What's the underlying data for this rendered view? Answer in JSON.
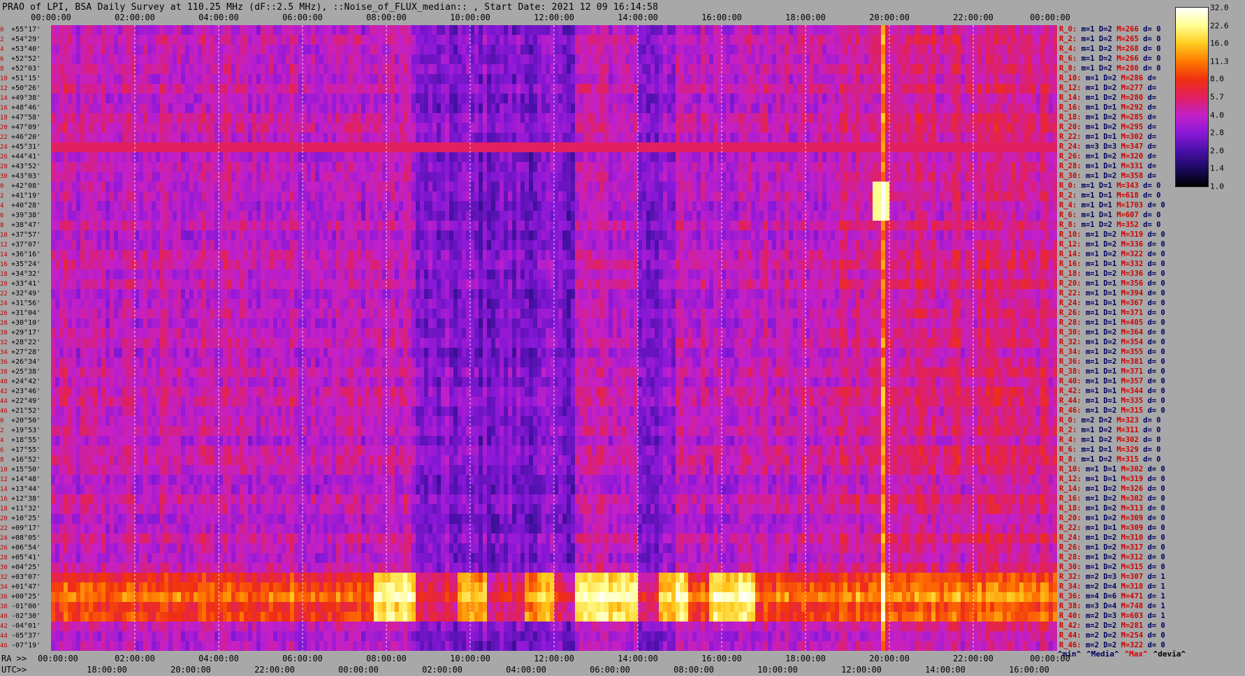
{
  "title": "PRAO of LPI, BSA Daily Survey at 110.25 MHz (dF::2.5 MHz), ::Noise_of_FLUX_median:: , Start Date: 2021 12 09 16:14:58",
  "chart_data": {
    "type": "heatmap",
    "title": "PRAO of LPI, BSA Daily Survey at 110.25 MHz (dF::2.5 MHz), ::Noise_of_FLUX_median:: , Start Date: 2021 12 09 16:14:58",
    "x_top_ticks": [
      "00:00:00",
      "02:00:00",
      "04:00:00",
      "06:00:00",
      "08:00:00",
      "10:00:00",
      "12:00:00",
      "14:00:00",
      "16:00:00",
      "18:00:00",
      "20:00:00",
      "22:00:00",
      "00:00:00"
    ],
    "x_ra_prefix": "RA >>",
    "x_ra_ticks": [
      "00:00:00",
      "02:00:00",
      "04:00:00",
      "06:00:00",
      "08:00:00",
      "10:00:00",
      "12:00:00",
      "14:00:00",
      "16:00:00",
      "18:00:00",
      "20:00:00",
      "22:00:00",
      "00:00:00"
    ],
    "x_utc_prefix": "UTC>>",
    "x_utc_ticks": [
      "18:00:00",
      "20:00:00",
      "22:00:00",
      "00:00:00",
      "02:00:00",
      "04:00:00",
      "06:00:00",
      "08:00:00",
      "10:00:00",
      "12:00:00",
      "14:00:00",
      "16:00:00"
    ],
    "declinations": [
      "+55°17'",
      "+54°29'",
      "+53°40'",
      "+52°52'",
      "+52°03'",
      "+51°15'",
      "+50°26'",
      "+49°38'",
      "+48°46'",
      "+47°58'",
      "+47°09'",
      "+46°20'",
      "+45°31'",
      "+44°41'",
      "+43°52'",
      "+43°03'",
      "+42°08'",
      "+41°19'",
      "+40°28'",
      "+39°38'",
      "+38°47'",
      "+37°57'",
      "+37°07'",
      "+36°16'",
      "+35°24'",
      "+34°32'",
      "+33°41'",
      "+32°49'",
      "+31°56'",
      "+31°04'",
      "+30°10'",
      "+29°17'",
      "+28°22'",
      "+27°28'",
      "+26°34'",
      "+25°38'",
      "+24°42'",
      "+23°46'",
      "+22°49'",
      "+21°52'",
      "+20°50'",
      "+19°53'",
      "+18°55'",
      "+17°55'",
      "+16°52'",
      "+15°50'",
      "+14°48'",
      "+13°44'",
      "+12°38'",
      "+11°32'",
      "+10°25'",
      "+09°17'",
      "+08°05'",
      "+06°54'",
      "+05°41'",
      "+04°25'",
      "+03°07'",
      "+01°47'",
      "+00°25'",
      "-01°00'",
      "-02°30'",
      "-04°01'",
      "-05°37'",
      "-07°19'"
    ],
    "beam_index": [
      "0",
      "2",
      "4",
      "6",
      "8",
      "10",
      "12",
      "14",
      "16",
      "18",
      "20",
      "22",
      "24",
      "26",
      "28",
      "30",
      "0",
      "2",
      "4",
      "6",
      "8",
      "10",
      "12",
      "14",
      "16",
      "18",
      "20",
      "22",
      "24",
      "26",
      "28",
      "30",
      "32",
      "34",
      "36",
      "38",
      "40",
      "42",
      "44",
      "46",
      "0",
      "2",
      "4",
      "6",
      "8",
      "10",
      "12",
      "14",
      "16",
      "18",
      "20",
      "22",
      "24",
      "26",
      "28",
      "30",
      "32",
      "34",
      "36",
      "38",
      "40",
      "42",
      "44",
      "46"
    ],
    "colorbar": {
      "scale": "log",
      "min": 1.0,
      "max": 32.0,
      "ticks": [
        "32.0",
        "22.6",
        "16.0",
        "11.3",
        "8.0",
        "5.7",
        "4.0",
        "2.8",
        "2.0",
        "1.4",
        "1.0"
      ],
      "colors": [
        "#000000",
        "#1a0a60",
        "#4a10a8",
        "#8a18d8",
        "#c420c8",
        "#e02060",
        "#f03010",
        "#ff7a00",
        "#ffcc20",
        "#ffff90",
        "#ffffff"
      ]
    },
    "stats_rows": [
      {
        "r": "R_0:",
        "m": "m=1",
        "d": "D=2",
        "mx": "M=266",
        "dv": "d= 0"
      },
      {
        "r": "R_2:",
        "m": "m=1",
        "d": "D=2",
        "mx": "M=265",
        "dv": "d= 0"
      },
      {
        "r": "R_4:",
        "m": "m=1",
        "d": "D=2",
        "mx": "M=268",
        "dv": "d= 0"
      },
      {
        "r": "R_6:",
        "m": "m=1",
        "d": "D=2",
        "mx": "M=266",
        "dv": "d= 0"
      },
      {
        "r": "R_8:",
        "m": "m=1",
        "d": "D=2",
        "mx": "M=280",
        "dv": "d= 0"
      },
      {
        "r": "R_10:",
        "m": "m=1",
        "d": "D=2",
        "mx": "M=286",
        "dv": "d="
      },
      {
        "r": "R_12:",
        "m": "m=1",
        "d": "D=2",
        "mx": "M=277",
        "dv": "d="
      },
      {
        "r": "R_14:",
        "m": "m=1",
        "d": "D=2",
        "mx": "M=280",
        "dv": "d="
      },
      {
        "r": "R_16:",
        "m": "m=1",
        "d": "D=1",
        "mx": "M=292",
        "dv": "d="
      },
      {
        "r": "R_18:",
        "m": "m=1",
        "d": "D=2",
        "mx": "M=285",
        "dv": "d="
      },
      {
        "r": "R_20:",
        "m": "m=1",
        "d": "D=2",
        "mx": "M=295",
        "dv": "d="
      },
      {
        "r": "R_22:",
        "m": "m=1",
        "d": "D=1",
        "mx": "M=302",
        "dv": "d="
      },
      {
        "r": "R_24:",
        "m": "m=3",
        "d": "D=3",
        "mx": "M=347",
        "dv": "d="
      },
      {
        "r": "R_26:",
        "m": "m=1",
        "d": "D=2",
        "mx": "M=320",
        "dv": "d="
      },
      {
        "r": "R_28:",
        "m": "m=1",
        "d": "D=1",
        "mx": "M=331",
        "dv": "d="
      },
      {
        "r": "R_30:",
        "m": "m=1",
        "d": "D=2",
        "mx": "M=358",
        "dv": "d="
      },
      {
        "r": "R_0:",
        "m": "m=1",
        "d": "D=1",
        "mx": "M=343",
        "dv": "d= 0"
      },
      {
        "r": "R_2:",
        "m": "m=1",
        "d": "D=1",
        "mx": "M=618",
        "dv": "d= 0"
      },
      {
        "r": "R_4:",
        "m": "m=1",
        "d": "D=1",
        "mx": "M=1703",
        "dv": "d= 0"
      },
      {
        "r": "R_6:",
        "m": "m=1",
        "d": "D=1",
        "mx": "M=607",
        "dv": "d= 0"
      },
      {
        "r": "R_8:",
        "m": "m=1",
        "d": "D=2",
        "mx": "M=352",
        "dv": "d= 0"
      },
      {
        "r": "R_10:",
        "m": "m=1",
        "d": "D=2",
        "mx": "M=319",
        "dv": "d= 0"
      },
      {
        "r": "R_12:",
        "m": "m=1",
        "d": "D=2",
        "mx": "M=336",
        "dv": "d= 0"
      },
      {
        "r": "R_14:",
        "m": "m=1",
        "d": "D=2",
        "mx": "M=322",
        "dv": "d= 0"
      },
      {
        "r": "R_16:",
        "m": "m=1",
        "d": "D=1",
        "mx": "M=332",
        "dv": "d= 0"
      },
      {
        "r": "R_18:",
        "m": "m=1",
        "d": "D=2",
        "mx": "M=336",
        "dv": "d= 0"
      },
      {
        "r": "R_20:",
        "m": "m=1",
        "d": "D=1",
        "mx": "M=356",
        "dv": "d= 0"
      },
      {
        "r": "R_22:",
        "m": "m=1",
        "d": "D=1",
        "mx": "M=394",
        "dv": "d= 0"
      },
      {
        "r": "R_24:",
        "m": "m=1",
        "d": "D=1",
        "mx": "M=367",
        "dv": "d= 0"
      },
      {
        "r": "R_26:",
        "m": "m=1",
        "d": "D=1",
        "mx": "M=371",
        "dv": "d= 0"
      },
      {
        "r": "R_28:",
        "m": "m=1",
        "d": "D=1",
        "mx": "M=405",
        "dv": "d= 0"
      },
      {
        "r": "R_30:",
        "m": "m=1",
        "d": "D=2",
        "mx": "M=364",
        "dv": "d= 0"
      },
      {
        "r": "R_32:",
        "m": "m=1",
        "d": "D=2",
        "mx": "M=354",
        "dv": "d= 0"
      },
      {
        "r": "R_34:",
        "m": "m=1",
        "d": "D=2",
        "mx": "M=355",
        "dv": "d= 0"
      },
      {
        "r": "R_36:",
        "m": "m=1",
        "d": "D=2",
        "mx": "M=381",
        "dv": "d= 0"
      },
      {
        "r": "R_38:",
        "m": "m=1",
        "d": "D=1",
        "mx": "M=371",
        "dv": "d= 0"
      },
      {
        "r": "R_40:",
        "m": "m=1",
        "d": "D=1",
        "mx": "M=357",
        "dv": "d= 0"
      },
      {
        "r": "R_42:",
        "m": "m=1",
        "d": "D=1",
        "mx": "M=344",
        "dv": "d= 0"
      },
      {
        "r": "R_44:",
        "m": "m=1",
        "d": "D=1",
        "mx": "M=335",
        "dv": "d= 0"
      },
      {
        "r": "R_46:",
        "m": "m=1",
        "d": "D=2",
        "mx": "M=315",
        "dv": "d= 0"
      },
      {
        "r": "R_0:",
        "m": "m=2",
        "d": "D=2",
        "mx": "M=323",
        "dv": "d= 0"
      },
      {
        "r": "R_2:",
        "m": "m=1",
        "d": "D=2",
        "mx": "M=311",
        "dv": "d= 0"
      },
      {
        "r": "R_4:",
        "m": "m=1",
        "d": "D=2",
        "mx": "M=302",
        "dv": "d= 0"
      },
      {
        "r": "R_6:",
        "m": "m=1",
        "d": "D=1",
        "mx": "M=329",
        "dv": "d= 0"
      },
      {
        "r": "R_8:",
        "m": "m=1",
        "d": "D=2",
        "mx": "M=315",
        "dv": "d= 0"
      },
      {
        "r": "R_10:",
        "m": "m=1",
        "d": "D=1",
        "mx": "M=302",
        "dv": "d= 0"
      },
      {
        "r": "R_12:",
        "m": "m=1",
        "d": "D=1",
        "mx": "M=319",
        "dv": "d= 0"
      },
      {
        "r": "R_14:",
        "m": "m=1",
        "d": "D=2",
        "mx": "M=326",
        "dv": "d= 0"
      },
      {
        "r": "R_16:",
        "m": "m=1",
        "d": "D=2",
        "mx": "M=302",
        "dv": "d= 0"
      },
      {
        "r": "R_18:",
        "m": "m=1",
        "d": "D=2",
        "mx": "M=313",
        "dv": "d= 0"
      },
      {
        "r": "R_20:",
        "m": "m=1",
        "d": "D=2",
        "mx": "M=309",
        "dv": "d= 0"
      },
      {
        "r": "R_22:",
        "m": "m=1",
        "d": "D=1",
        "mx": "M=309",
        "dv": "d= 0"
      },
      {
        "r": "R_24:",
        "m": "m=1",
        "d": "D=2",
        "mx": "M=310",
        "dv": "d= 0"
      },
      {
        "r": "R_26:",
        "m": "m=1",
        "d": "D=2",
        "mx": "M=317",
        "dv": "d= 0"
      },
      {
        "r": "R_28:",
        "m": "m=1",
        "d": "D=2",
        "mx": "M=312",
        "dv": "d= 0"
      },
      {
        "r": "R_30:",
        "m": "m=1",
        "d": "D=2",
        "mx": "M=315",
        "dv": "d= 0"
      },
      {
        "r": "R_32:",
        "m": "m=2",
        "d": "D=3",
        "mx": "M=307",
        "dv": "d= 1"
      },
      {
        "r": "R_34:",
        "m": "m=2",
        "d": "D=4",
        "mx": "M=318",
        "dv": "d= 1"
      },
      {
        "r": "R_36:",
        "m": "m=4",
        "d": "D=6",
        "mx": "M=471",
        "dv": "d= 1"
      },
      {
        "r": "R_38:",
        "m": "m=3",
        "d": "D=4",
        "mx": "M=748",
        "dv": "d= 1"
      },
      {
        "r": "R_40:",
        "m": "m=2",
        "d": "D=3",
        "mx": "M=603",
        "dv": "d= 1"
      },
      {
        "r": "R_42:",
        "m": "m=2",
        "d": "D=2",
        "mx": "M=281",
        "dv": "d= 0"
      },
      {
        "r": "R_44:",
        "m": "m=2",
        "d": "D=2",
        "mx": "M=254",
        "dv": "d= 0"
      },
      {
        "r": "R_46:",
        "m": "m=2",
        "d": "D=2",
        "mx": "M=322",
        "dv": "d= 0"
      }
    ],
    "stats_legend": [
      "^min^",
      "^Media^",
      "^Max^",
      "^devia^"
    ]
  }
}
